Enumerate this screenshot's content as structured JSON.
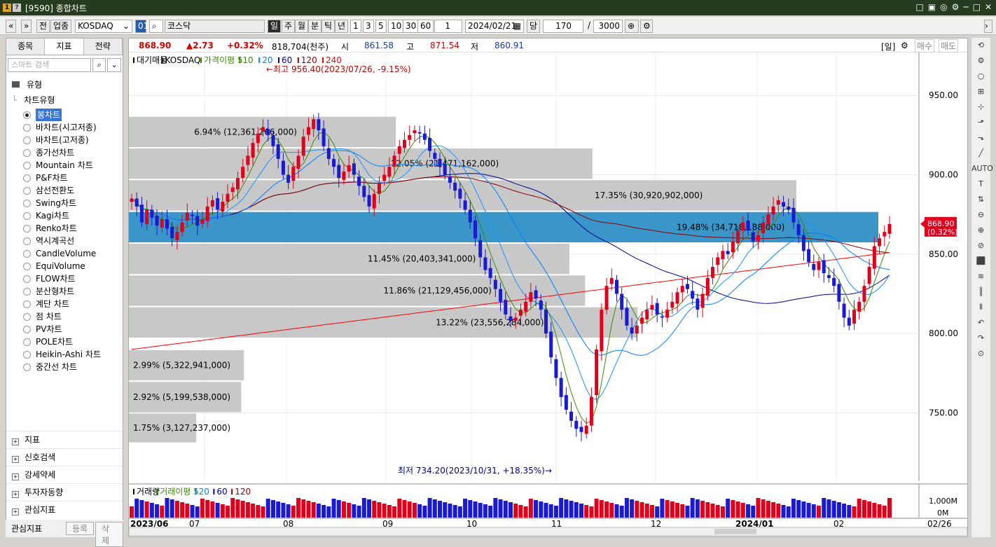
{
  "window": {
    "title": "[9590] 종합차트",
    "logo1": "1",
    "logo2": "?",
    "controls": [
      "□",
      "▣",
      "◎",
      "⚙",
      "─",
      "□",
      "✕"
    ]
  },
  "toolbar": {
    "nav": [
      "«",
      "»"
    ],
    "buttons_left": [
      "전",
      "업종"
    ],
    "code": "KOSDAQ",
    "market": "코스닥",
    "periods": [
      "일",
      "주",
      "월",
      "분",
      "틱",
      "년"
    ],
    "selected_period": "일",
    "minutes": [
      "1",
      "3",
      "5",
      "10",
      "30",
      "60"
    ],
    "count_unit": "1",
    "date": "2024/02/21",
    "dang": "당",
    "count": "170",
    "slash": "/",
    "total": "3000"
  },
  "left_panel": {
    "tabs": [
      "종목",
      "지표",
      "전략"
    ],
    "active_tab": "지표",
    "search_placeholder": "스마트 검색",
    "group_label": "유형",
    "subgroup_label": "차트유형",
    "chart_types": [
      "봉차트",
      "바차트(시고저종)",
      "바차트(고저종)",
      "종가선차트",
      "Mountain 차트",
      "P&F차트",
      "삼선전환도",
      "Swing차트",
      "Kagi차트",
      "Renko차트",
      "역시계곡선",
      "CandleVolume",
      "EquiVolume",
      "FLOW차트",
      "분산형차트",
      "계단 차트",
      "점 차트",
      "PV차트",
      "POLE차트",
      "Heikin-Ashi 차트",
      "중간선 차트"
    ],
    "selected_chart_type": "봉차트",
    "folders": [
      "지표",
      "신호검색",
      "강세약세",
      "투자자동향",
      "관심지표"
    ],
    "bottom": {
      "label": "관심지표",
      "register": "등록",
      "delete": "삭제"
    }
  },
  "infobar": {
    "price": "868.90",
    "change": "▲2.73",
    "change_pct": "+0.32%",
    "volume": "818,704(천주)",
    "open_label": "시",
    "open": "861.58",
    "high_label": "고",
    "high": "871.54",
    "low_label": "저",
    "low": "860.91",
    "right_labels": [
      "[일]",
      "매수",
      "매도"
    ]
  },
  "legend": {
    "items": [
      "대기매물",
      "KOSDAQ",
      "가격이평 5",
      "10",
      "20",
      "60",
      "120",
      "240"
    ],
    "colors": [
      "#000000",
      "#000000",
      "#3a8a00",
      "#3a8a00",
      "#0080ff",
      "#0000a0",
      "#8b0000",
      "#ff0000"
    ]
  },
  "volume_legend": {
    "items": [
      "거래량",
      "거래이평 5",
      "20",
      "60",
      "120"
    ],
    "colors": [
      "#000000",
      "#3a8a00",
      "#0080ff",
      "#0000a0",
      "#8b0000"
    ]
  },
  "icons": {
    "search": "search-icon",
    "settings": "gear-icon",
    "calendar": "calendar-icon"
  },
  "chart_data": {
    "type": "candlestick",
    "y_ticks": [
      950,
      900,
      850,
      800,
      750
    ],
    "y_tick_labels": [
      "950.00",
      "900.00",
      "850.00",
      "800.00",
      "750.00"
    ],
    "ylim": [
      707,
      977
    ],
    "x_labels": [
      "2023/06",
      "07",
      "08",
      "09",
      "10",
      "11",
      "12",
      "2024/01",
      "02",
      "02/26"
    ],
    "current_price_label": [
      "868.90",
      "(0.32%)"
    ],
    "annotations": {
      "high": "←최고 956.40(2023/07/26, -9.15%)",
      "low": "최저 734.20(2023/10/31, +18.35%)→"
    },
    "volume_profile": [
      {
        "label": "1.75% (3,127,237,000)",
        "pct": 1.75,
        "low": 731,
        "high": 750
      },
      {
        "label": "2.92% (5,199,538,000)",
        "pct": 2.92,
        "low": 750,
        "high": 770
      },
      {
        "label": "2.99% (5,322,941,000)",
        "pct": 2.99,
        "low": 770,
        "high": 790
      },
      {
        "label": "13.22% (23,556,284,000)",
        "pct": 13.22,
        "low": 797,
        "high": 817
      },
      {
        "label": "11.86% (21,129,456,000)",
        "pct": 11.86,
        "low": 817,
        "high": 837
      },
      {
        "label": "11.45% (20,403,341,000)",
        "pct": 11.45,
        "low": 837,
        "high": 857
      },
      {
        "label": "19.48% (34,718,188,000)",
        "pct": 19.48,
        "low": 857,
        "high": 877
      },
      {
        "label": "17.35% (30,920,902,000)",
        "pct": 17.35,
        "low": 877,
        "high": 897
      },
      {
        "label": "12.05% (21,471,162,000)",
        "pct": 12.05,
        "low": 897,
        "high": 917
      },
      {
        "label": "6.94% (12,361,266,000)",
        "pct": 6.94,
        "low": 917,
        "high": 937
      }
    ],
    "close": [
      885,
      880,
      870,
      878,
      873,
      868,
      872,
      866,
      860,
      864,
      870,
      876,
      874,
      868,
      872,
      880,
      884,
      878,
      883,
      888,
      892,
      898,
      905,
      912,
      920,
      926,
      930,
      925,
      918,
      910,
      900,
      895,
      905,
      912,
      924,
      930,
      935,
      928,
      918,
      910,
      905,
      898,
      902,
      906,
      900,
      893,
      886,
      880,
      888,
      895,
      900,
      905,
      912,
      918,
      922,
      925,
      928,
      926,
      922,
      915,
      910,
      905,
      900,
      895,
      890,
      885,
      878,
      870,
      860,
      848,
      840,
      835,
      828,
      820,
      812,
      808,
      810,
      815,
      820,
      826,
      822,
      815,
      800,
      785,
      772,
      760,
      752,
      745,
      740,
      738,
      742,
      760,
      790,
      815,
      830,
      835,
      825,
      815,
      805,
      800,
      805,
      810,
      815,
      818,
      812,
      810,
      815,
      820,
      826,
      830,
      828,
      822,
      815,
      825,
      835,
      842,
      848,
      852,
      850,
      858,
      865,
      870,
      865,
      858,
      862,
      870,
      875,
      880,
      884,
      880,
      878,
      870,
      862,
      852,
      845,
      840,
      845,
      838,
      835,
      830,
      820,
      810,
      805,
      815,
      820,
      830,
      842,
      855,
      860,
      864,
      869
    ],
    "volume_ref": "1,000M",
    "volume_ref2": "0M"
  },
  "right_toolbar": [
    "⟲",
    "⚙",
    "○",
    "⊞",
    "⊹",
    "⬏",
    "⬎",
    "╱",
    "AUTO",
    "T",
    "⇅",
    "⊖",
    "⊕",
    "⊘",
    "⬛",
    "≋",
    "║",
    "⦀",
    "↶",
    "↷",
    "⊙"
  ]
}
